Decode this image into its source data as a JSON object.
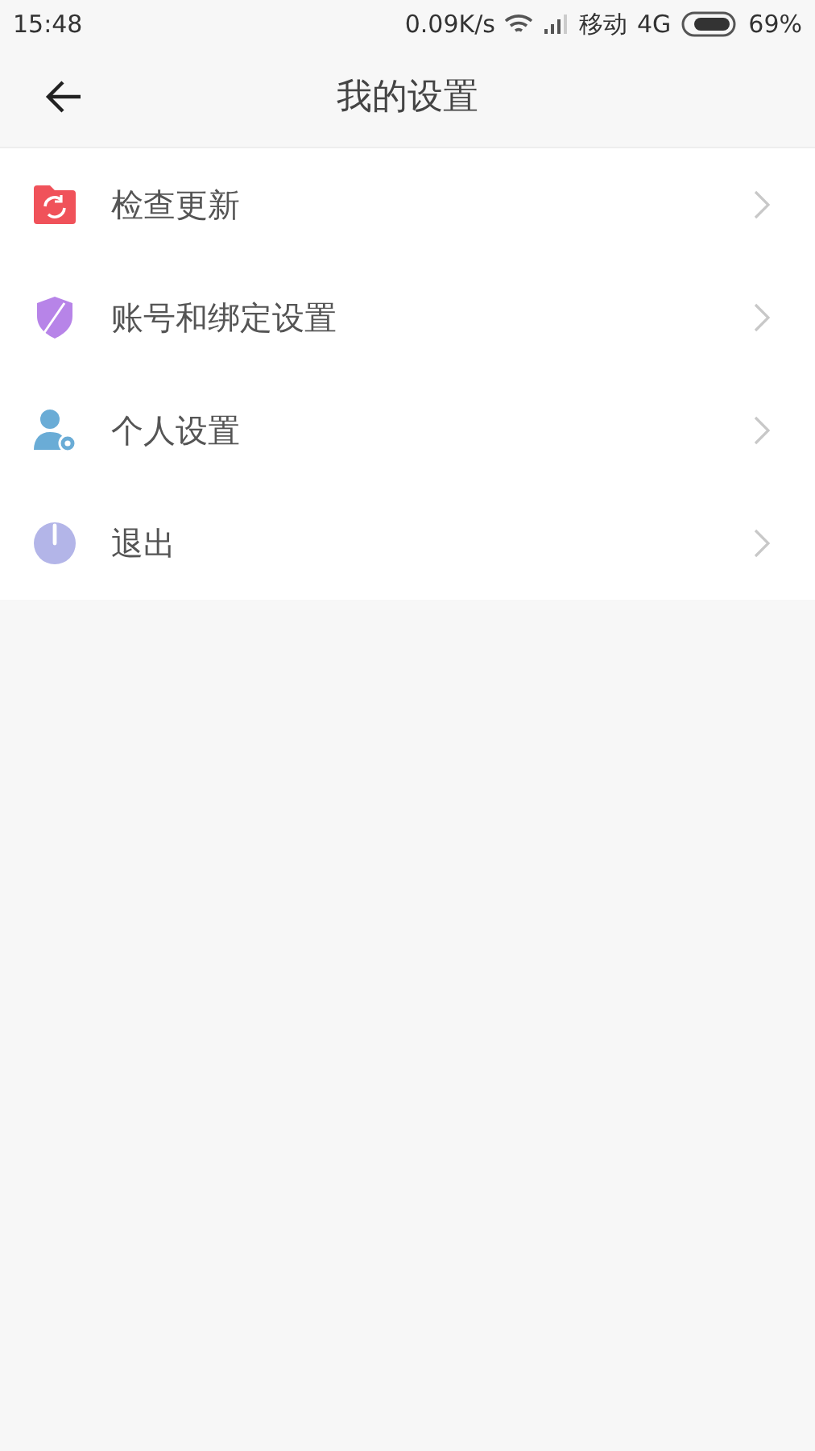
{
  "status_bar": {
    "time": "15:48",
    "speed": "0.09K/s",
    "carrier": "移动",
    "network": "4G",
    "battery": "69%"
  },
  "header": {
    "title": "我的设置"
  },
  "items": [
    {
      "kind": "update",
      "label": "检查更新"
    },
    {
      "kind": "account",
      "label": "账号和绑定设置"
    },
    {
      "kind": "personal",
      "label": "个人设置"
    },
    {
      "kind": "logout",
      "label": "退出"
    }
  ]
}
